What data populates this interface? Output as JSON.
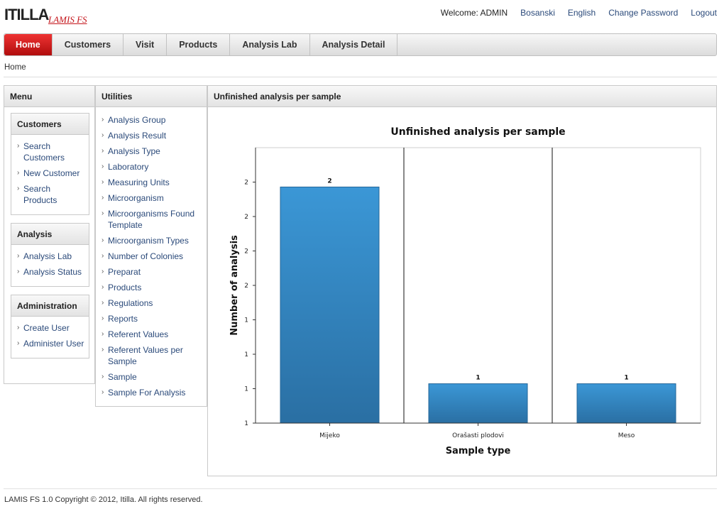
{
  "header": {
    "logo_text": "ITILLA",
    "logo_subtitle": "LAMIS FS",
    "welcome": "Welcome: ADMIN",
    "links": [
      "Bosanski",
      "English",
      "Change Password",
      "Logout"
    ]
  },
  "nav": {
    "tabs": [
      "Home",
      "Customers",
      "Visit",
      "Products",
      "Analysis Lab",
      "Analysis Detail"
    ],
    "active": "Home"
  },
  "breadcrumb": "Home",
  "menu": {
    "title": "Menu",
    "sections": [
      {
        "title": "Customers",
        "items": [
          "Search Customers",
          "New Customer",
          "Search Products"
        ]
      },
      {
        "title": "Analysis",
        "items": [
          "Analysis Lab",
          "Analysis Status"
        ]
      },
      {
        "title": "Administration",
        "items": [
          "Create User",
          "Administer User"
        ]
      }
    ]
  },
  "utilities": {
    "title": "Utilities",
    "items": [
      "Analysis Group",
      "Analysis Result",
      "Analysis Type",
      "Laboratory",
      "Measuring Units",
      "Microorganism",
      "Microorganisms Found Template",
      "Microorganism Types",
      "Number of Colonies",
      "Preparat",
      "Products",
      "Regulations",
      "Reports",
      "Referent Values",
      "Referent Values per Sample",
      "Sample",
      "Sample For Analysis"
    ]
  },
  "chart_panel": {
    "title": "Unfinished analysis per sample"
  },
  "chart_data": {
    "type": "bar",
    "title": "Unfinished analysis per sample",
    "xlabel": "Sample type",
    "ylabel": "Number of analysis",
    "categories": [
      "Mijeko",
      "Orašasti plodovi",
      "Meso"
    ],
    "values": [
      2,
      1,
      1
    ],
    "ylim": [
      0.8,
      2.2
    ],
    "y_tick_labels": [
      "2",
      "2",
      "2",
      "2",
      "1",
      "1",
      "1",
      "1"
    ],
    "bar_color": "#2e86c4",
    "grid": false
  },
  "footer": "LAMIS FS 1.0 Copyright © 2012, Itilla. All rights reserved."
}
